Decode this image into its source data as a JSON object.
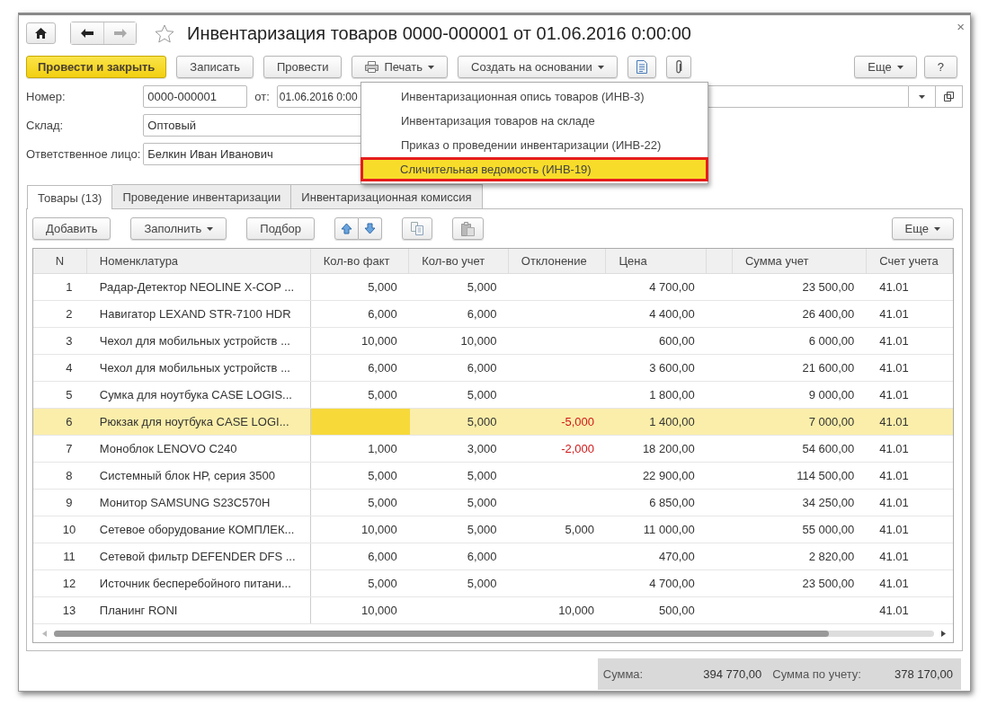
{
  "window": {
    "title": "Инвентаризация товаров 0000-000001 от 01.06.2016 0:00:00",
    "close": "×"
  },
  "toolbar": {
    "left": [
      {
        "label": "Провести и закрыть",
        "kind": "primary"
      },
      {
        "label": "Записать",
        "kind": "plain"
      },
      {
        "label": "Провести",
        "kind": "plain"
      },
      {
        "label": "Печать",
        "kind": "print"
      },
      {
        "label": "Создать на основании",
        "kind": "menu"
      },
      {
        "kind": "document"
      },
      {
        "kind": "clip"
      }
    ],
    "right": [
      {
        "label": "Еще",
        "kind": "menu"
      },
      {
        "label": "?",
        "kind": "plain"
      }
    ]
  },
  "print_menu": {
    "items": [
      {
        "label": "Инвентаризационная опись товаров (ИНВ-3)",
        "selected": false
      },
      {
        "label": "Инвентаризация товаров на складе",
        "selected": false
      },
      {
        "label": "Приказ о проведении инвентаризации (ИНВ-22)",
        "selected": false
      },
      {
        "label": "Сличительная ведомость (ИНВ-19)",
        "selected": true
      }
    ]
  },
  "form": {
    "number": {
      "label": "Номер:",
      "value": "0000-000001"
    },
    "date": {
      "label": "от:",
      "value": "01.06.2016  0:00"
    },
    "warehouse": {
      "label": "Склад:",
      "value": "Оптовый"
    },
    "responsible": {
      "label": "Ответственное лицо:",
      "value": "Белкин Иван Иванович"
    }
  },
  "tabs": [
    {
      "label": "Товары (13)",
      "selected": true
    },
    {
      "label": "Проведение инвентаризации",
      "selected": false
    },
    {
      "label": "Инвентаризационная комиссия",
      "selected": false
    }
  ],
  "table_toolbar": {
    "left": [
      {
        "label": "Добавить",
        "kind": "plain"
      },
      {
        "label": "Заполнить",
        "kind": "menu"
      },
      {
        "label": "Подбор",
        "kind": "plain"
      },
      {
        "kind": "up"
      },
      {
        "kind": "down"
      },
      {
        "kind": "copy"
      },
      {
        "kind": "paste"
      }
    ],
    "right": [
      {
        "label": "Еще",
        "kind": "menu"
      }
    ]
  },
  "table": {
    "columns": [
      "N",
      "Номенклатура",
      "Кол-во факт",
      "Кол-во учет",
      "Отклонение",
      "Цена",
      "Сумма учет",
      "Счет учета"
    ],
    "rows": [
      {
        "n": "1",
        "item": "Радар-Детектор NEOLINE X-COP ...",
        "qty_fact": "5,000",
        "qty_book": "5,000",
        "price": "4 700,00",
        "sum_book": "23 500,00",
        "account": "41.01",
        "selected": false
      },
      {
        "n": "2",
        "item": "Навигатор LEXAND STR-7100 HDR",
        "qty_fact": "6,000",
        "qty_book": "6,000",
        "price": "4 400,00",
        "sum_book": "26 400,00",
        "account": "41.01",
        "selected": false
      },
      {
        "n": "3",
        "item": "Чехол для мобильных устройств  ...",
        "qty_fact": "10,000",
        "qty_book": "10,000",
        "price": "600,00",
        "sum_book": "6 000,00",
        "account": "41.01",
        "selected": false
      },
      {
        "n": "4",
        "item": "Чехол для мобильных устройств ...",
        "qty_fact": "6,000",
        "qty_book": "6,000",
        "price": "3 600,00",
        "sum_book": "21 600,00",
        "account": "41.01",
        "selected": false
      },
      {
        "n": "5",
        "item": "Сумка для ноутбука CASE LOGIS...",
        "qty_fact": "5,000",
        "qty_book": "5,000",
        "price": "1 800,00",
        "sum_book": "9 000,00",
        "account": "41.01",
        "selected": false
      },
      {
        "n": "6",
        "item": "Рюкзак для ноутбука CASE LOGI...",
        "qty_book": "5,000",
        "deviation": "-5,000",
        "deviation_negative": true,
        "price": "1 400,00",
        "sum_book": "7 000,00",
        "account": "41.01",
        "selected": true,
        "fact_cell_active": true
      },
      {
        "n": "7",
        "item": "Моноблок  LENOVO C240",
        "qty_fact": "1,000",
        "qty_book": "3,000",
        "deviation": "-2,000",
        "deviation_negative": true,
        "price": "18 200,00",
        "sum_book": "54 600,00",
        "account": "41.01",
        "selected": false
      },
      {
        "n": "8",
        "item": "Системный блок HP, серия 3500",
        "qty_fact": "5,000",
        "qty_book": "5,000",
        "price": "22 900,00",
        "sum_book": "114 500,00",
        "account": "41.01",
        "selected": false
      },
      {
        "n": "9",
        "item": "Монитор  SAMSUNG S23C570H",
        "qty_fact": "5,000",
        "qty_book": "5,000",
        "price": "6 850,00",
        "sum_book": "34 250,00",
        "account": "41.01",
        "selected": false
      },
      {
        "n": "10",
        "item": "Сетевое оборудование КОМПЛЕК...",
        "qty_fact": "10,000",
        "qty_book": "5,000",
        "deviation": "5,000",
        "deviation_negative": false,
        "price": "11 000,00",
        "sum_book": "55 000,00",
        "account": "41.01",
        "selected": false
      },
      {
        "n": "11",
        "item": "Сетевой фильтр DEFENDER DFS ...",
        "qty_fact": "6,000",
        "qty_book": "6,000",
        "price": "470,00",
        "sum_book": "2 820,00",
        "account": "41.01",
        "selected": false
      },
      {
        "n": "12",
        "item": "Источник бесперебойного  питани...",
        "qty_fact": "5,000",
        "qty_book": "5,000",
        "price": "4 700,00",
        "sum_book": "23 500,00",
        "account": "41.01",
        "selected": false
      },
      {
        "n": "13",
        "item": "Планинг RONI",
        "qty_fact": "10,000",
        "deviation": "10,000",
        "deviation_negative": false,
        "price": "500,00",
        "account": "41.01",
        "selected": false
      }
    ]
  },
  "totals": [
    {
      "label": "Сумма:",
      "value": "394 770,00"
    },
    {
      "label": "Сумма по учету:",
      "value": "378 170,00"
    }
  ]
}
